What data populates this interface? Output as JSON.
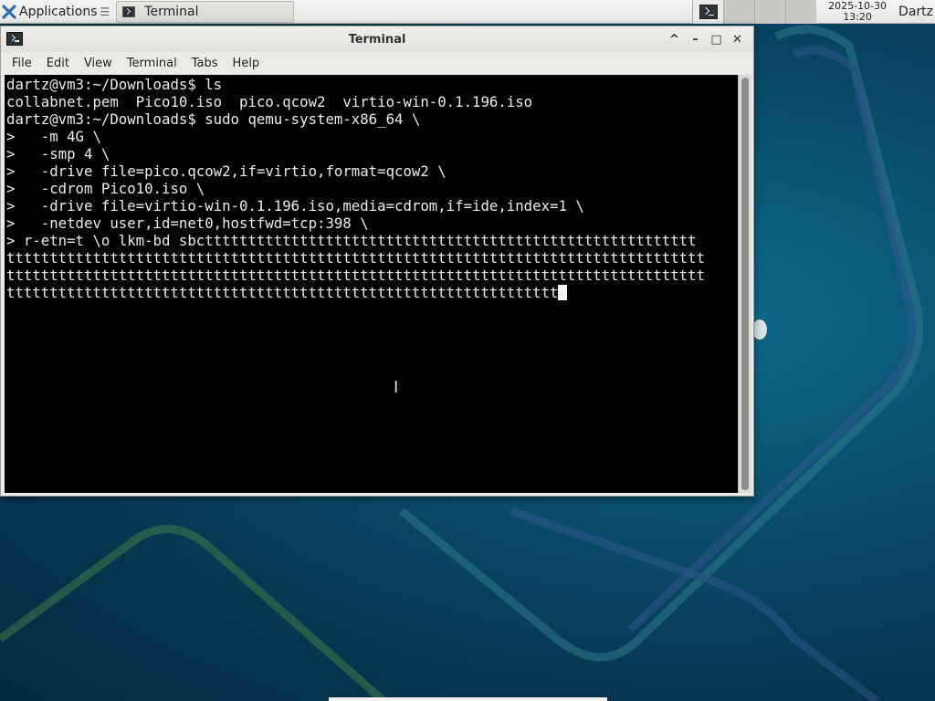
{
  "panel": {
    "applications_label": "Applications",
    "taskbar_item": "Terminal",
    "clock_date": "2025-10-30",
    "clock_time": "13:20",
    "user": "Dartz"
  },
  "window": {
    "title": "Terminal",
    "menu": [
      "File",
      "Edit",
      "View",
      "Terminal",
      "Tabs",
      "Help"
    ],
    "buttons": {
      "maximize_glyph": "□",
      "close_glyph": "✕",
      "minimize_glyph": "–",
      "shade_glyph": "^"
    }
  },
  "terminal": {
    "lines": [
      "dartz@vm3:~/Downloads$ ls",
      "collabnet.pem  Pico10.iso  pico.qcow2  virtio-win-0.1.196.iso",
      "dartz@vm3:~/Downloads$ sudo qemu-system-x86_64 \\",
      ">   -m 4G \\",
      ">   -smp 4 \\",
      ">   -drive file=pico.qcow2,if=virtio,format=qcow2 \\",
      ">   -cdrom Pico10.iso \\",
      ">   -drive file=virtio-win-0.1.196.iso,media=cdrom,if=ide,index=1 \\",
      ">   -netdev user,id=net0,hostfwd=tcp:398 \\",
      "> r-etn=t \\o lkm-bd sbcttttttttttttttttttttttttttttttttttttttttttttttttttttttttt",
      "ttttttttttttttttttttttttttttttttttttttttttttttttttttttttttttttttttttttttttttttttt",
      "ttttttttttttttttttttttttttttttttttttttttttttttttttttttttttttttttttttttttttttttttt",
      "tttttttttttttttttttttttttttttttttttttttttttttttttttttttttttttttt"
    ]
  },
  "colors": {
    "terminal_bg": "#000000",
    "terminal_fg": "#ececec",
    "desktop_bg": "#0a4f6e"
  }
}
